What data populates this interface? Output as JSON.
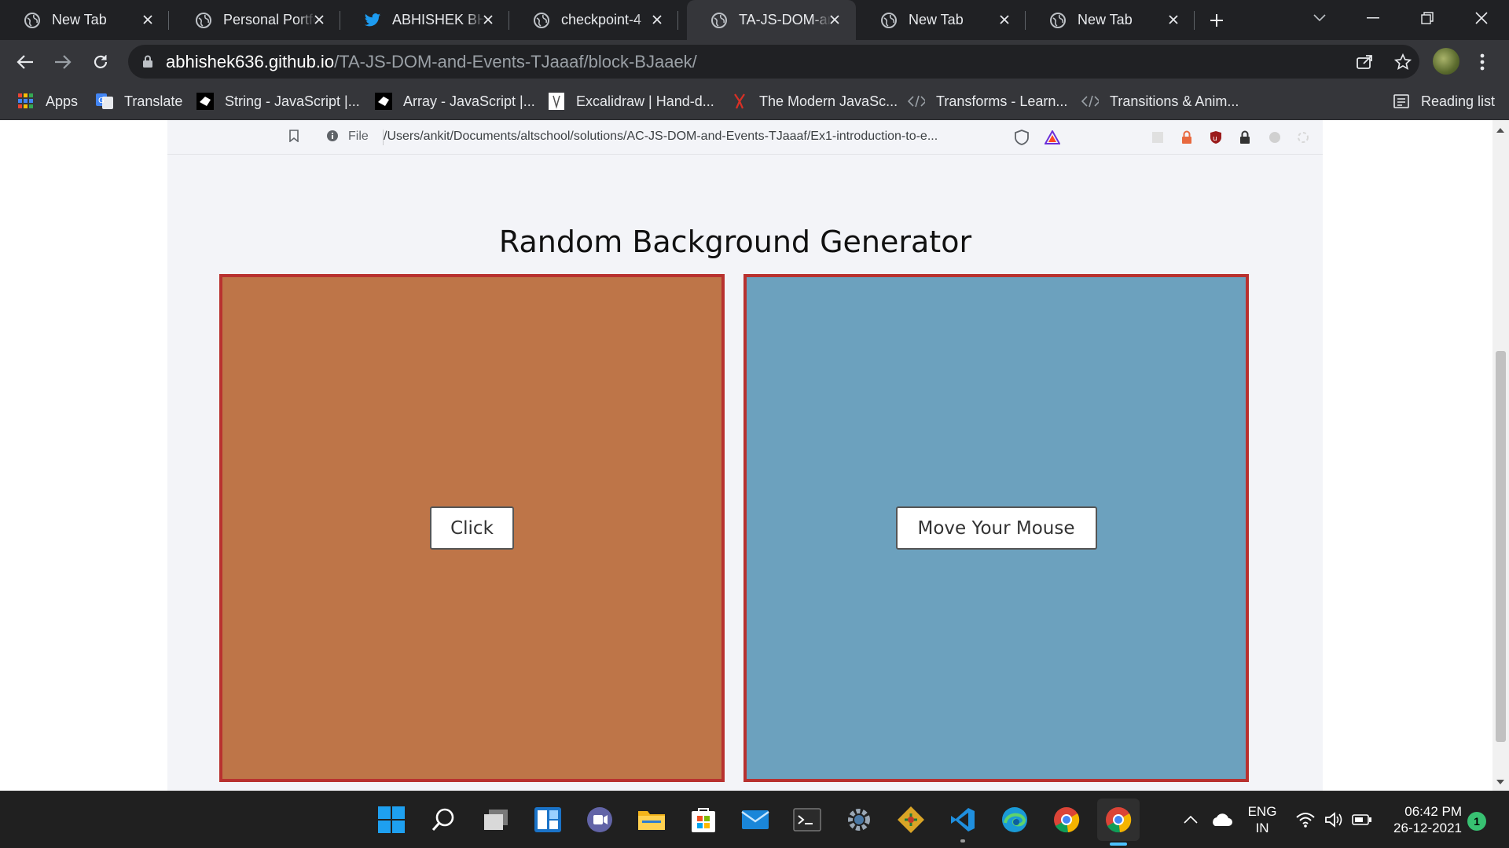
{
  "browser": {
    "tabs": [
      {
        "title": "New Tab",
        "icon": "globe-icon"
      },
      {
        "title": "Personal Portfolio",
        "icon": "globe-icon"
      },
      {
        "title": "ABHISHEK BHARDWAJ",
        "icon": "twitter-icon"
      },
      {
        "title": "checkpoint-4",
        "icon": "globe-icon"
      },
      {
        "title": "TA-JS-DOM-and-Events",
        "icon": "globe-icon",
        "active": true
      },
      {
        "title": "New Tab",
        "icon": "globe-icon"
      },
      {
        "title": "New Tab",
        "icon": "globe-icon"
      }
    ],
    "url_host": "abhishek636.github.io",
    "url_path": "/TA-JS-DOM-and-Events-TJaaaf/block-BJaaek/",
    "bookmarks": [
      {
        "label": "Apps",
        "icon": "apps-grid-icon"
      },
      {
        "label": "Translate",
        "icon": "google-translate-icon"
      },
      {
        "label": "String - JavaScript |...",
        "icon": "mdn-icon"
      },
      {
        "label": "Array - JavaScript |...",
        "icon": "mdn-icon"
      },
      {
        "label": "Excalidraw | Hand-d...",
        "icon": "excalidraw-icon"
      },
      {
        "label": "The Modern JavaSc...",
        "icon": "javascript-info-icon"
      },
      {
        "label": "Transforms - Learn...",
        "icon": "code-brackets-icon"
      },
      {
        "label": "Transitions & Anim...",
        "icon": "code-brackets-icon"
      }
    ],
    "reading_list": "Reading list"
  },
  "inner_screenshot": {
    "file_label": "File",
    "path": "/Users/ankit/Documents/altschool/solutions/AC-JS-DOM-and-Events-TJaaaf/Ex1-introduction-to-e..."
  },
  "page": {
    "title": "Random Background Generator",
    "left_panel": {
      "button_label": "Click",
      "background": "#be7548"
    },
    "right_panel": {
      "button_label": "Move Your Mouse",
      "background": "#6ca1be"
    },
    "border_color": "#b8312f"
  },
  "taskbar": {
    "apps": [
      "windows-start-icon",
      "search-icon",
      "task-view-icon",
      "widgets-icon",
      "teams-chat-icon",
      "file-explorer-icon",
      "microsoft-store-icon",
      "mail-icon",
      "terminal-icon",
      "settings-icon",
      "git-icon",
      "vscode-icon",
      "edge-icon",
      "chrome-icon",
      "chrome-active-icon"
    ],
    "lang_1": "ENG",
    "lang_2": "IN",
    "time": "06:42 PM",
    "date": "26-12-2021",
    "notifications": "1"
  }
}
